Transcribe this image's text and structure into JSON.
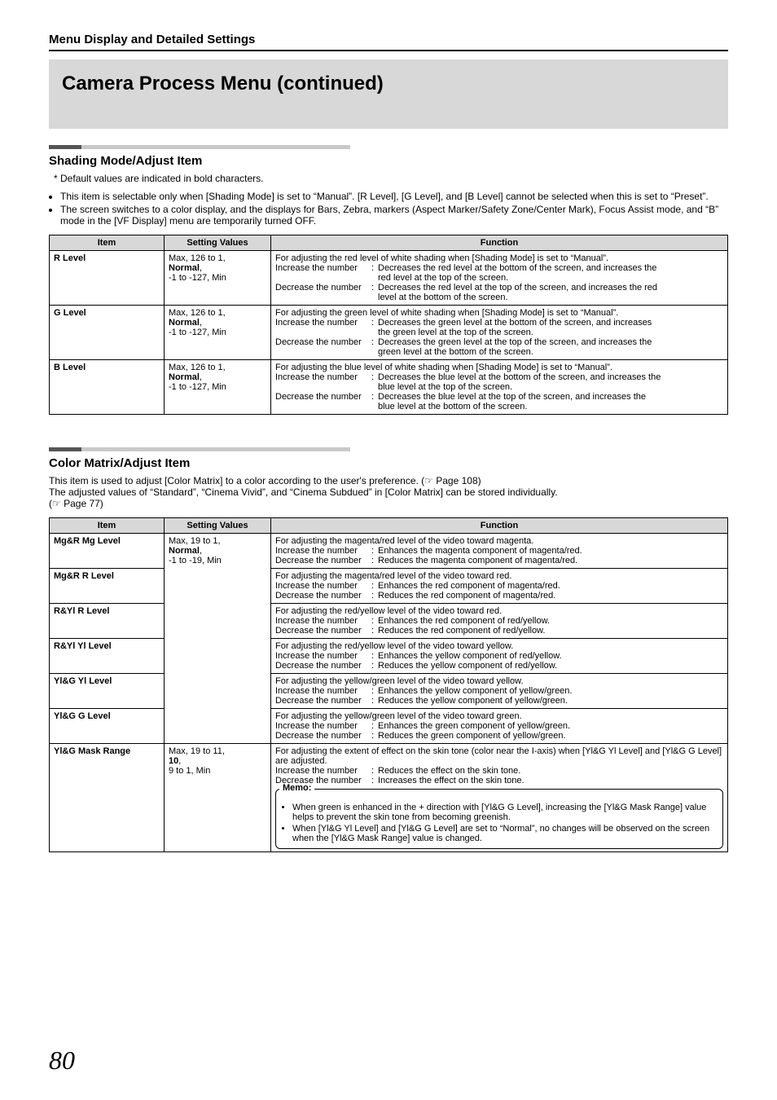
{
  "header": {
    "section": "Menu Display and Detailed Settings",
    "title": "Camera Process Menu (continued)"
  },
  "shading": {
    "heading": "Shading Mode/Adjust Item",
    "defaultsNote": "Default values are indicated in bold characters.",
    "bullets": [
      "This item is selectable only when [Shading Mode] is set to “Manual”. [R Level], [G Level], and [B Level] cannot be selected when this is set to “Preset”.",
      "The screen switches to a color display, and the displays for Bars, Zebra, markers (Aspect Marker/Safety Zone/Center Mark), Focus Assist mode, and “B” mode in the [VF Display] menu are temporarily turned OFF."
    ],
    "table": {
      "thItem": "Item",
      "thSV": "Setting Values",
      "thFunc": "Function",
      "rows": [
        {
          "item": "R Level",
          "sv1": "Max, 126 to 1,",
          "sv2_bold": "Normal",
          "sv2_after": ",",
          "sv3": "-1 to -127, Min",
          "fdesc": "For adjusting the red level of white shading when [Shading Mode] is set to “Manual”.",
          "incLabel": "Increase the number",
          "incText1": "Decreases the red level at the bottom of the screen, and increases the",
          "incText2": "red level at the top of the screen.",
          "decLabel": "Decrease the number",
          "decText1": "Decreases the red level at the top of the screen, and increases the red",
          "decText2": "level at the bottom of the screen."
        },
        {
          "item": "G Level",
          "sv1": "Max, 126 to 1,",
          "sv2_bold": "Normal",
          "sv2_after": ",",
          "sv3": "-1 to -127, Min",
          "fdesc": "For adjusting the green level of white shading when [Shading Mode] is set to “Manual”.",
          "incLabel": "Increase the number",
          "incText1": "Decreases the green level at the bottom of the screen, and increases",
          "incText2": "the green level at the top of the screen.",
          "decLabel": "Decrease the number",
          "decText1": "Decreases the green level at the top of the screen, and increases the",
          "decText2": "green level at the bottom of the screen."
        },
        {
          "item": "B Level",
          "sv1": "Max, 126 to 1,",
          "sv2_bold": "Normal",
          "sv2_after": ",",
          "sv3": "-1 to -127, Min",
          "fdesc": "For adjusting the blue level of white shading when [Shading Mode] is set to “Manual”.",
          "incLabel": "Increase the number",
          "incText1": "Decreases the blue level at the bottom of the screen, and increases the",
          "incText2": "blue level at the top of the screen.",
          "decLabel": "Decrease the number",
          "decText1": "Decreases the blue level at the top of the screen, and increases the",
          "decText2": "blue level at the bottom of the screen."
        }
      ]
    }
  },
  "colormatrix": {
    "heading": "Color Matrix/Adjust Item",
    "desc1": "This item is used to adjust [Color Matrix] to a color according to the user's preference. (☞  Page 108)",
    "desc2": "The adjusted values of “Standard”, “Cinema Vivid”, and “Cinema Subdued” in [Color Matrix] can be stored individually.",
    "desc3": "(☞  Page 77)",
    "table": {
      "thItem": "Item",
      "thSV": "Setting Values",
      "thFunc": "Function",
      "svShared": {
        "l1": "Max, 19 to 1,",
        "l2_bold": "Normal",
        "l2_after": ",",
        "l3": "-1 to -19, Min"
      },
      "svMask": {
        "l1": "Max, 19 to 11,",
        "l2_bold": "10",
        "l2_after": ",",
        "l3": "9 to 1, Min"
      },
      "rows": [
        {
          "item": "Mg&R Mg Level",
          "fdesc": "For adjusting the magenta/red level of the video toward magenta.",
          "inc": "Enhances the magenta component of magenta/red.",
          "dec": "Reduces the magenta component of magenta/red."
        },
        {
          "item": "Mg&R R Level",
          "fdesc": "For adjusting the magenta/red level of the video toward red.",
          "inc": "Enhances the red component of magenta/red.",
          "dec": "Reduces the red component of magenta/red."
        },
        {
          "item": "R&Yl R Level",
          "fdesc": "For adjusting the red/yellow level of the video toward red.",
          "inc": "Enhances the red component of red/yellow.",
          "dec": "Reduces the red component of red/yellow."
        },
        {
          "item": "R&Yl Yl Level",
          "fdesc": "For adjusting the red/yellow level of the video toward yellow.",
          "inc": "Enhances the yellow component of red/yellow.",
          "dec": "Reduces the yellow component of red/yellow."
        },
        {
          "item": "Yl&G Yl Level",
          "fdesc": "For adjusting the yellow/green level of the video toward yellow.",
          "inc": "Enhances the yellow component of yellow/green.",
          "dec": "Reduces the yellow component of yellow/green."
        },
        {
          "item": "Yl&G G Level",
          "fdesc": "For adjusting the yellow/green level of the video toward green.",
          "inc": "Enhances the green component of yellow/green.",
          "dec": "Reduces the green component of yellow/green."
        }
      ],
      "maskRow": {
        "item": "Yl&G Mask Range",
        "fdesc": "For adjusting the extent of effect on the skin tone (color near the I-axis) when [Yl&G Yl Level] and [Yl&G G Level] are adjusted.",
        "inc": "Reduces the effect on the skin tone.",
        "dec": "Increases the effect on the skin tone.",
        "memoLabel": "Memo:",
        "memo1": "When green is enhanced in the + direction with [Yl&G G Level], increasing the [Yl&G Mask Range] value helps to prevent the skin tone from becoming greenish.",
        "memo2": "When [Yl&G Yl Level] and [Yl&G G Level] are set to “Normal”, no changes will be observed on the screen when the [Yl&G Mask Range] value is changed."
      },
      "incLabel": "Increase the number",
      "decLabel": "Decrease the number"
    }
  },
  "pageNum": "80"
}
